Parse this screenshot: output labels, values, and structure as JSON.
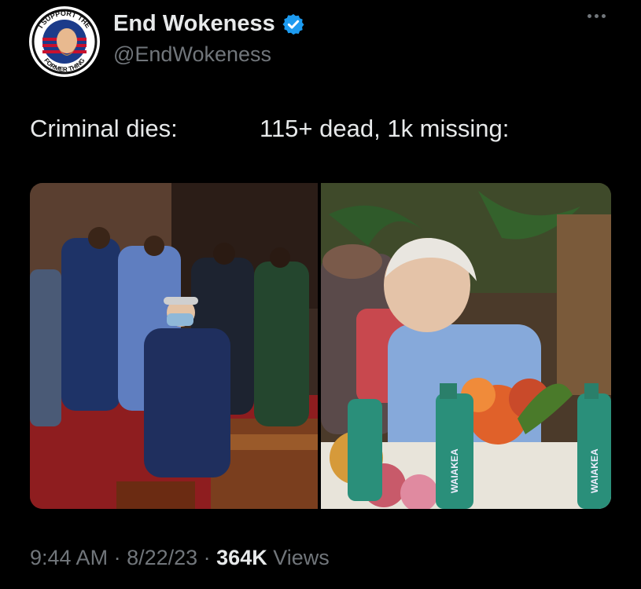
{
  "author": {
    "display_name": "End Wokeness",
    "handle": "@EndWokeness",
    "verified": true,
    "avatar_badge_top": "I SUPPORT THE",
    "avatar_badge_bottom": "FORMER THING",
    "avatar_icon": "bearded-man-flag-badge"
  },
  "tweet": {
    "text_left": "Criminal dies:",
    "text_right": "115+ dead, 1k missing:"
  },
  "media": {
    "right_bottle_label_1": "WAIAKEA",
    "right_bottle_label_2": "WAIAKEA"
  },
  "meta": {
    "time": "9:44 AM",
    "separator": " · ",
    "date": "8/22/23",
    "views_count": "364K",
    "views_label": " Views"
  },
  "colors": {
    "background": "#000000",
    "text_primary": "#e7e9ea",
    "text_secondary": "#71767b",
    "verified_blue": "#1d9bf0"
  }
}
